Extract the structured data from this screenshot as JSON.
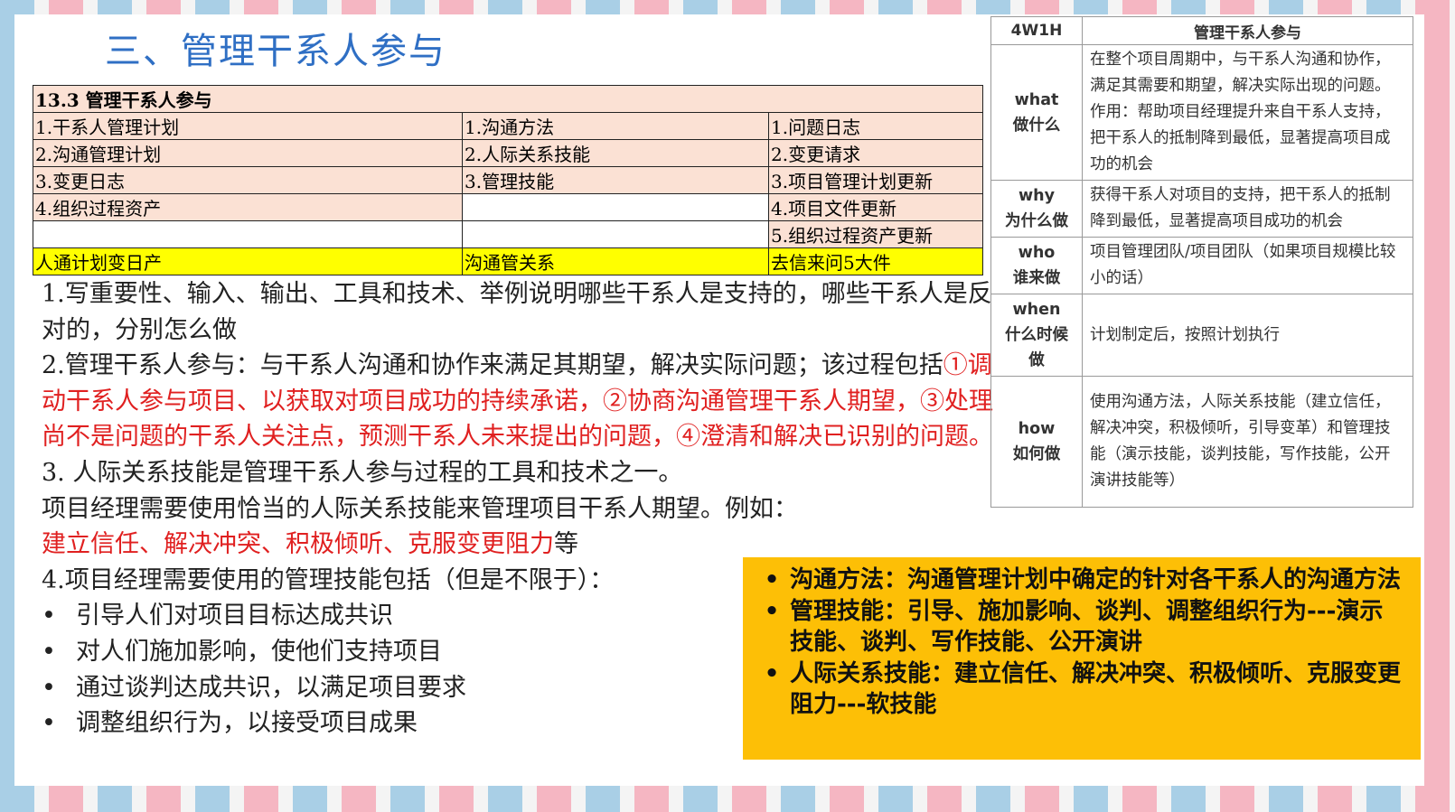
{
  "title": "三、管理干系人参与",
  "itto": {
    "header": "13.3 管理干系人参与",
    "rows": [
      [
        "1.干系人管理计划",
        "1.沟通方法",
        "1.问题日志"
      ],
      [
        "2.沟通管理计划",
        "2.人际关系技能",
        "2.变更请求"
      ],
      [
        "3.变更日志",
        "3.管理技能",
        "3.项目管理计划更新"
      ],
      [
        "4.组织过程资产",
        "",
        "4.项目文件更新"
      ],
      [
        "",
        "",
        "5.组织过程资产更新"
      ]
    ],
    "mnemonic": [
      "人通计划变日产",
      "沟通管关系",
      "去信来问5大件"
    ]
  },
  "body": {
    "p1": "1.写重要性、输入、输出、工具和技术、举例说明哪些干系人是支持的，哪些干系人是反对的，分别怎么做",
    "p2_prefix": "2.管理干系人参与：与干系人沟通和协作来满足其期望，解决实际问题；该过程包括",
    "p2_red": "①调动干系人参与项目、以获取对项目成功的持续承诺，②协商沟通管理干系人期望，③处理尚不是问题的干系人关注点，预测干系人未来提出的问题，④澄清和解决已识别的问题。",
    "p3": "3.  人际关系技能是管理干系人参与过程的工具和技术之一。",
    "p4": "项目经理需要使用恰当的人际关系技能来管理项目干系人期望。例如：",
    "p5_red": "建立信任、解决冲突、积极倾听、克服变更阻力",
    "p5_suffix": "等",
    "p6": "4.项目经理需要使用的管理技能包括（但是不限于）：",
    "bullets": [
      "引导人们对项目目标达成共识",
      "对人们施加影响，使他们支持项目",
      "通过谈判达成共识，以满足项目要求",
      "调整组织行为，以接受项目成果"
    ]
  },
  "w4": {
    "col1": "4W1H",
    "col2": "管理干系人参与",
    "rows": [
      {
        "en": "what",
        "zh": "做什么",
        "text": "在整个项目周期中，与干系人沟通和协作，满足其需要和期望，解决实际出现的问题。作用：帮助项目经理提升来自干系人支持，把干系人的抵制降到最低，显著提高项目成功的机会"
      },
      {
        "en": "why",
        "zh": "为什么做",
        "text": "获得干系人对项目的支持，把干系人的抵制降到最低，显著提高项目成功的机会"
      },
      {
        "en": "who",
        "zh": "谁来做",
        "text": "项目管理团队/项目团队（如果项目规模比较小的话）"
      },
      {
        "en": "when",
        "zh": "什么时候做",
        "text": "计划制定后，按照计划执行"
      },
      {
        "en": "how",
        "zh": "如何做",
        "text": "使用沟通方法，人际关系技能（建立信任，解决冲突，积极倾听，引导变革）和管理技能（演示技能，谈判技能，写作技能，公开演讲技能等）"
      }
    ]
  },
  "yellow_box": [
    "沟通方法：沟通管理计划中确定的针对各干系人的沟通方法",
    "管理技能：引导、施加影响、谈判、调整组织行为---演示技能、谈判、写作技能、公开演讲",
    "人际关系技能：建立信任、解决冲突、积极倾听、克服变更阻力---软技能"
  ],
  "colors": {
    "title": "#2f6fc4",
    "red_text": "#e02020",
    "pink_cell": "#fbe1d4",
    "yellow_cell": "#ffff00",
    "box": "#fdbf06"
  }
}
